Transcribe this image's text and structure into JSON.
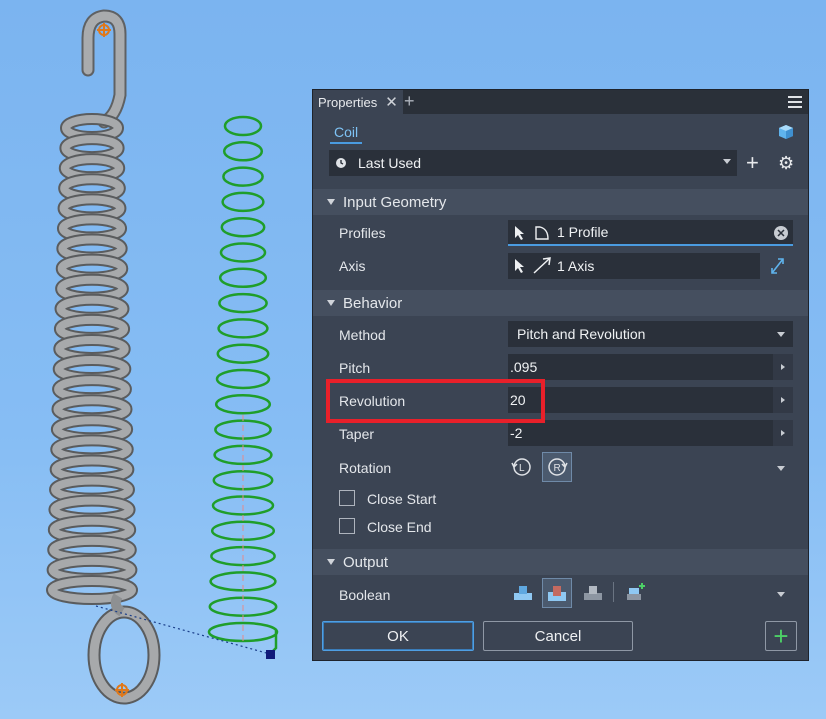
{
  "panel": {
    "tab_title": "Properties",
    "tab_close": "✕",
    "tab_add": "+",
    "feature_tab": "Coil",
    "preset": {
      "label": "Last Used"
    },
    "sections": {
      "input_geometry": {
        "title": "Input Geometry",
        "profiles_label": "Profiles",
        "profiles_value": "1 Profile",
        "axis_label": "Axis",
        "axis_value": "1 Axis"
      },
      "behavior": {
        "title": "Behavior",
        "method_label": "Method",
        "method_value": "Pitch and Revolution",
        "pitch_label": "Pitch",
        "pitch_value": ".095",
        "revolution_label": "Revolution",
        "revolution_value": "20",
        "taper_label": "Taper",
        "taper_value": "-2",
        "rotation_label": "Rotation",
        "close_start_label": "Close Start",
        "close_end_label": "Close End"
      },
      "output": {
        "title": "Output",
        "boolean_label": "Boolean"
      }
    },
    "buttons": {
      "ok": "OK",
      "cancel": "Cancel",
      "add": "+"
    }
  },
  "colors": {
    "background": "#86bdf4",
    "panel": "#3b4453",
    "accent": "#4a9be0",
    "highlight": "#e8202a",
    "coil_preview": "#1f9e2a"
  }
}
